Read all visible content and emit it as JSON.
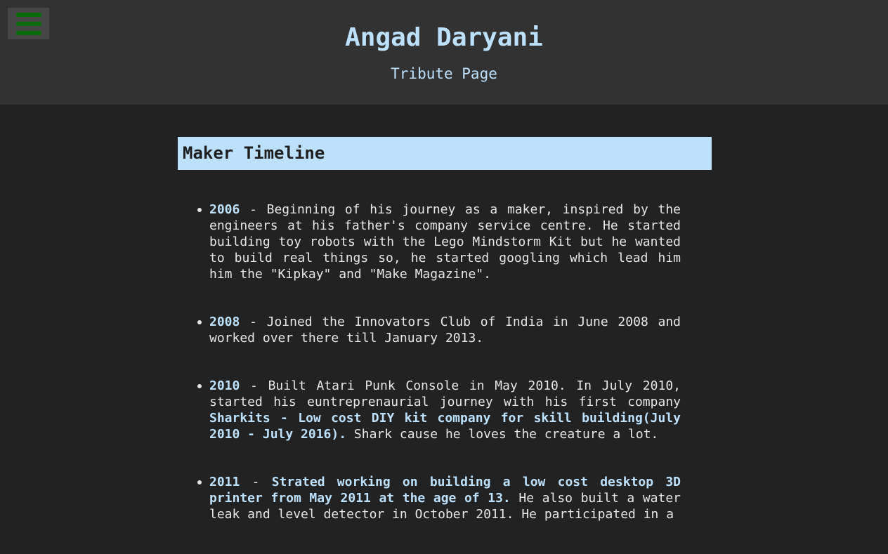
{
  "header": {
    "title": "Angad Daryani",
    "subtitle": "Tribute Page"
  },
  "colors": {
    "accent": "#bde1fd",
    "header_bg": "#333233",
    "page_bg": "#222222",
    "menu_icon": "#0a6b0a"
  },
  "menu": {
    "icon": "hamburger-menu-icon"
  },
  "section": {
    "heading": "Maker Timeline"
  },
  "timeline": [
    {
      "year": "2006",
      "text": " - Beginning of his journey as a maker, inspired by the engineers at his father's company service centre. He started building toy robots with the Lego Mindstorm Kit but he wanted to build real things so, he started googling which lead him him the \"Kipkay\" and \"Make Magazine\"."
    },
    {
      "year": "2008",
      "text": " - Joined the Innovators Club of India in June 2008 and worked over there till January 2013."
    },
    {
      "year": "2010",
      "text_before": " - Built Atari Punk Console in May 2010. In July 2010, started his euntreprenaurial journey with his first company ",
      "highlight": "Sharkits - Low cost DIY kit company for skill building(July 2010 - July 2016).",
      "text_after": " Shark cause he loves the creature a lot."
    },
    {
      "year": "2011",
      "text_before": " - ",
      "highlight": "Strated working on building a low cost desktop 3D printer from May 2011 at the age of 13.",
      "text_after": " He also built a water leak and level detector in October 2011. He participated in a"
    }
  ]
}
